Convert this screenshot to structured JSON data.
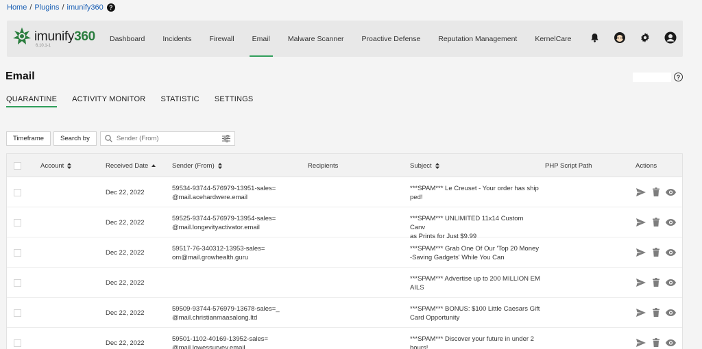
{
  "breadcrumb": {
    "items": [
      "Home",
      "Plugins",
      "imunify360"
    ],
    "separator": "/",
    "help": "?"
  },
  "brand": {
    "prefix": "imunify",
    "suffix": "360",
    "version": "6.10.1-1",
    "color": "#2a7d3e"
  },
  "nav": {
    "items": [
      "Dashboard",
      "Incidents",
      "Firewall",
      "Email",
      "Malware Scanner",
      "Proactive Defense",
      "Reputation Management",
      "KernelCare"
    ],
    "active": "Email",
    "icons": [
      "bell-icon",
      "support-agent-icon",
      "gear-icon",
      "user-icon"
    ]
  },
  "page": {
    "title": "Email",
    "help": "?"
  },
  "tabs": {
    "items": [
      "QUARANTINE",
      "ACTIVITY MONITOR",
      "STATISTIC",
      "SETTINGS"
    ],
    "active": "QUARANTINE"
  },
  "filters": {
    "timeframe": "Timeframe",
    "search_by": "Search by",
    "search_placeholder": "Sender (From)"
  },
  "table": {
    "headers": {
      "account": "Account",
      "received": "Received Date",
      "sender": "Sender (From)",
      "recipients": "Recipients",
      "subject": "Subject",
      "php": "PHP Script Path",
      "actions": "Actions"
    },
    "rows": [
      {
        "date": "Dec 22, 2022",
        "sender": "59534-93744-576979-13951-sales=\n@mail.acehardwere.email",
        "subject": "***SPAM*** Le Creuset - Your order has ship\nped!"
      },
      {
        "date": "Dec 22, 2022",
        "sender": "59525-93744-576979-13954-sales=\n@mail.longevityactivator.email",
        "subject": "***SPAM*** UNLIMITED 11x14 Custom Canv\nas Prints for Just $9.99"
      },
      {
        "date": "Dec 22, 2022",
        "sender": "59517-76-340312-13953-sales=\nom@mail.growhealth.guru",
        "subject": "***SPAM*** Grab One Of Our 'Top 20 Money\n-Saving Gadgets' While You Can"
      },
      {
        "date": "Dec 22, 2022",
        "sender": "",
        "subject": "***SPAM*** Advertise up to 200 MILLION EM\nAILS"
      },
      {
        "date": "Dec 22, 2022",
        "sender": "59509-93744-576979-13678-sales=_\n@mail.christianmaasalong.ltd",
        "subject": "***SPAM*** BONUS: $100 Little Caesars Gift\nCard Opportunity"
      },
      {
        "date": "Dec 22, 2022",
        "sender": "59501-1102-40169-13952-sales=\n@mail.lowessurvey.email",
        "subject": "***SPAM*** Discover your future in under 2\nhours!"
      }
    ],
    "action_icons": [
      "send-icon",
      "trash-icon",
      "eye-icon"
    ]
  },
  "colors": {
    "accent": "#2f9e5a",
    "link": "#1a5fb4",
    "icon": "#7d7d7d"
  }
}
